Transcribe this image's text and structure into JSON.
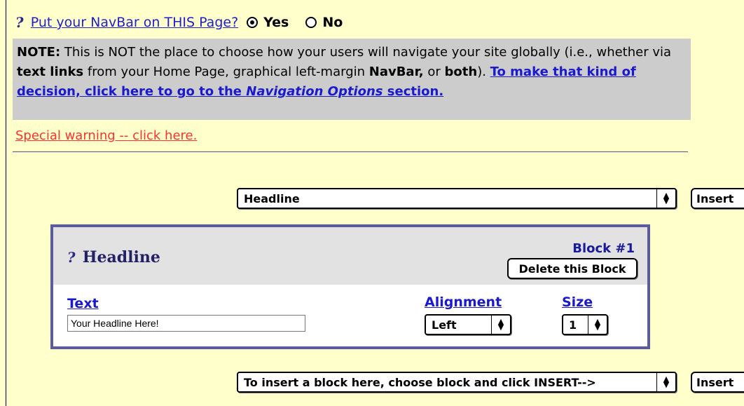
{
  "navbar_question": {
    "label": "Put your NavBar on THIS Page?",
    "yes": "Yes",
    "no": "No",
    "selected": "Yes"
  },
  "note": {
    "prefix": "NOTE:",
    "text1": " This is NOT the place to choose how your users will navigate your site globally (i.e., whether via ",
    "bold1": "text links",
    "text2": " from your Home Page, graphical left-margin ",
    "bold2": "NavBar,",
    "text3": " or ",
    "bold3": "both",
    "text4": "). ",
    "link_text": "To make that kind of decision, click here to go to the ",
    "link_italic": "Navigation Options",
    "link_end": " section."
  },
  "warning_link": "Special warning -- click here.",
  "top_select": {
    "value": "Headline",
    "insert_label": "Insert"
  },
  "block": {
    "title": "Headline",
    "number_label": "Block #1",
    "delete_label": "Delete this Block",
    "text_label": "Text",
    "text_value": "Your Headline Here!",
    "alignment_label": "Alignment",
    "alignment_value": "Left",
    "size_label": "Size",
    "size_value": "1"
  },
  "bottom_select": {
    "value": "To insert a block here, choose block and click INSERT-->",
    "insert_label": "Insert"
  },
  "icons": {
    "help": "help-icon",
    "select_arrow": "updown-arrow-icon"
  }
}
